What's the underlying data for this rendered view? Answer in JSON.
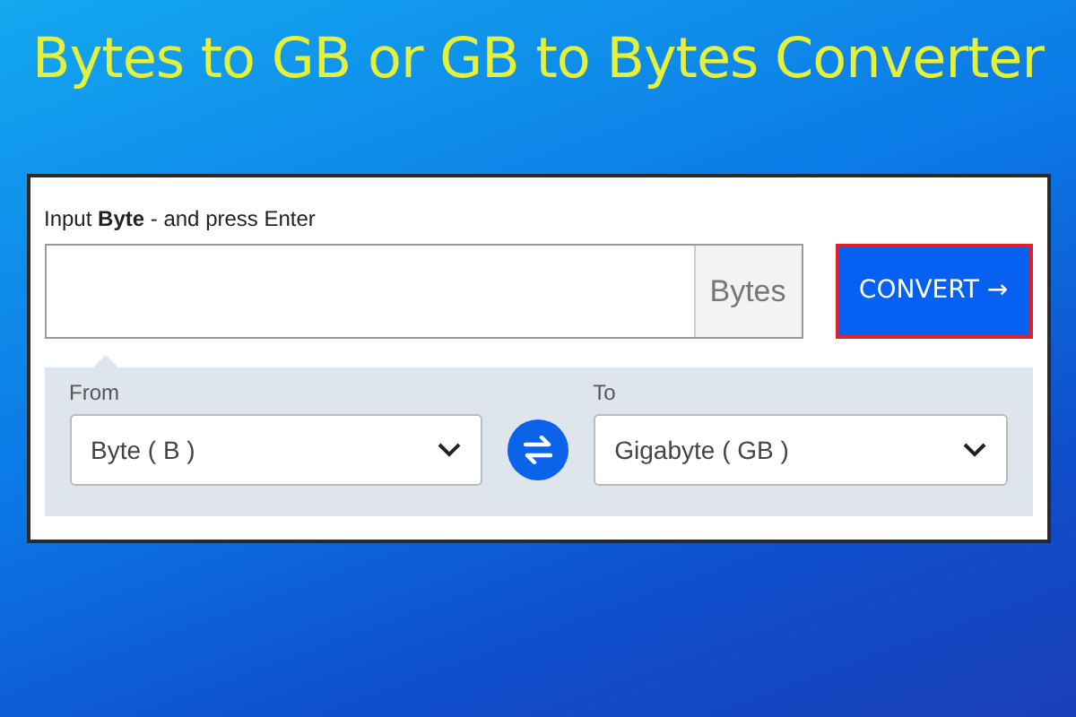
{
  "title": "Bytes to GB or GB to Bytes Converter",
  "input": {
    "label": "Input **Byte** - and press Enter",
    "unit": "Bytes"
  },
  "convert_button": {
    "label": "CONVERT →",
    "focused": true
  },
  "from": {
    "label": "From",
    "value": "Byte ( B )"
  },
  "to": {
    "label": "To",
    "value": "Gigabyte ( GB )"
  }
}
